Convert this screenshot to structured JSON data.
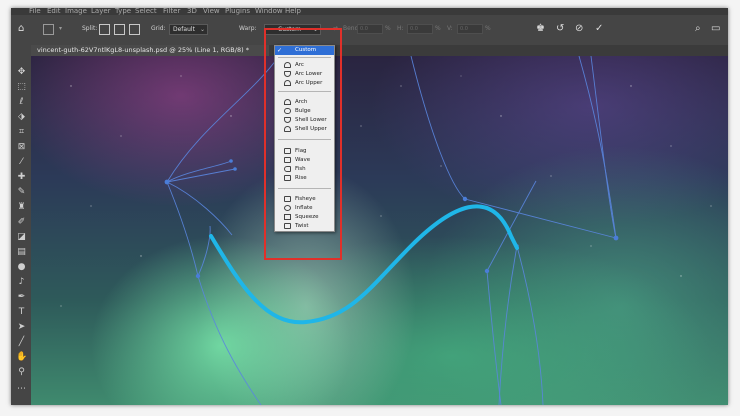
{
  "menubar": {
    "items": [
      "File",
      "Edit",
      "Image",
      "Layer",
      "Type",
      "Select",
      "Filter",
      "3D",
      "View",
      "Plugins",
      "Window",
      "Help"
    ]
  },
  "options": {
    "split_label": "Split:",
    "grid_label": "Grid:",
    "grid_value": "Default",
    "warp_label": "Warp:",
    "warp_value": "Custom",
    "bend_label": "Bend:",
    "bend_value": "0.0",
    "h_label": "H:",
    "h_value": "0.0",
    "v_label": "V:",
    "v_value": "0.0",
    "percent": "%"
  },
  "document": {
    "tab_title": "vincent-guth-62V7ntlKgL8-unsplash.psd @ 25% (Line 1, RGB/8) *"
  },
  "tools": [
    "move-icon",
    "marquee-icon",
    "lasso-icon",
    "object-select-icon",
    "crop-icon",
    "frame-icon",
    "eyedropper-icon",
    "healing-icon",
    "brush-icon",
    "stamp-icon",
    "history-brush-icon",
    "eraser-icon",
    "gradient-icon",
    "blur-icon",
    "dodge-icon",
    "pen-icon",
    "type-icon",
    "path-select-icon",
    "line-icon",
    "hand-icon",
    "zoom-icon",
    "more-icon"
  ],
  "warp_menu": {
    "items": [
      {
        "label": "Custom",
        "selected": true,
        "icon": "check-icon"
      },
      {
        "label": "Arc",
        "icon": "arc-icon"
      },
      {
        "label": "Arc Lower",
        "icon": "arc-lower-icon"
      },
      {
        "label": "Arc Upper",
        "icon": "arc-upper-icon"
      },
      {
        "label": "Arch",
        "icon": "arch-icon"
      },
      {
        "label": "Bulge",
        "icon": "bulge-icon"
      },
      {
        "label": "Shell Lower",
        "icon": "shell-lower-icon"
      },
      {
        "label": "Shell Upper",
        "icon": "shell-upper-icon"
      },
      {
        "label": "Flag",
        "icon": "flag-icon"
      },
      {
        "label": "Wave",
        "icon": "wave-icon"
      },
      {
        "label": "Fish",
        "icon": "fish-icon"
      },
      {
        "label": "Rise",
        "icon": "rise-icon"
      },
      {
        "label": "Fisheye",
        "icon": "fisheye-icon"
      },
      {
        "label": "Inflate",
        "icon": "inflate-icon"
      },
      {
        "label": "Squeeze",
        "icon": "squeeze-icon"
      },
      {
        "label": "Twist",
        "icon": "twist-icon"
      }
    ]
  },
  "colors": {
    "warp_line": "#1fb6e8",
    "handles": "#4a7dd8",
    "highlight": "#e0302a",
    "menu_selected": "#2f6fd6"
  }
}
